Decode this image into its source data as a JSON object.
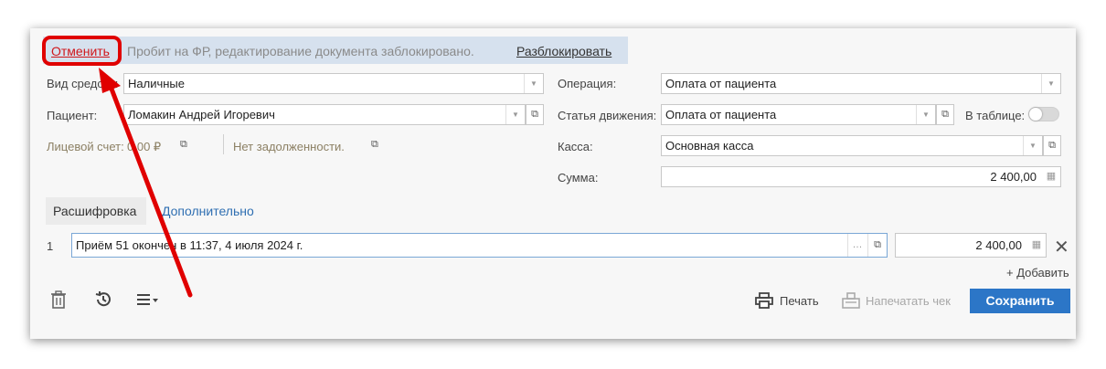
{
  "banner": {
    "cancel_label": "Отменить",
    "message": "Пробит на ФР, редактирование документа заблокировано.",
    "unlock_label": "Разблокировать"
  },
  "form": {
    "fund_type_label": "Вид средств:",
    "fund_type_value": "Наличные",
    "patient_label": "Пациент:",
    "patient_value": "Ломакин Андрей Игоревич",
    "account_label": "Лицевой счет:",
    "account_value": "0,00 ₽",
    "debt_label": "Нет задолженности.",
    "operation_label": "Операция:",
    "operation_value": "Оплата от пациента",
    "movement_label": "Статья движения:",
    "movement_value": "Оплата от пациента",
    "in_table_label": "В таблице:",
    "in_table_on": false,
    "cashbox_label": "Касса:",
    "cashbox_value": "Основная касса",
    "sum_label": "Сумма:",
    "sum_value": "2 400,00"
  },
  "tabs": [
    {
      "label": "Расшифровка",
      "active": true
    },
    {
      "label": "Дополнительно",
      "active": false
    }
  ],
  "rows": [
    {
      "num": "1",
      "description": "Приём 51 окончен в 11:37, 4 июля 2024 г.",
      "amount": "2 400,00"
    }
  ],
  "add_label": "+ Добавить",
  "footer": {
    "print_label": "Печать",
    "print_receipt_label": "Напечатать чек",
    "save_label": "Сохранить"
  },
  "colors": {
    "accent": "#2c76c7",
    "banner_bg": "#d6e1ee",
    "callout": "#e00000"
  },
  "icons": [
    "trash-icon",
    "history-icon",
    "menu-icon",
    "printer-icon",
    "receipt-printer-icon",
    "calculator-icon",
    "open-link-icon",
    "close-icon"
  ]
}
